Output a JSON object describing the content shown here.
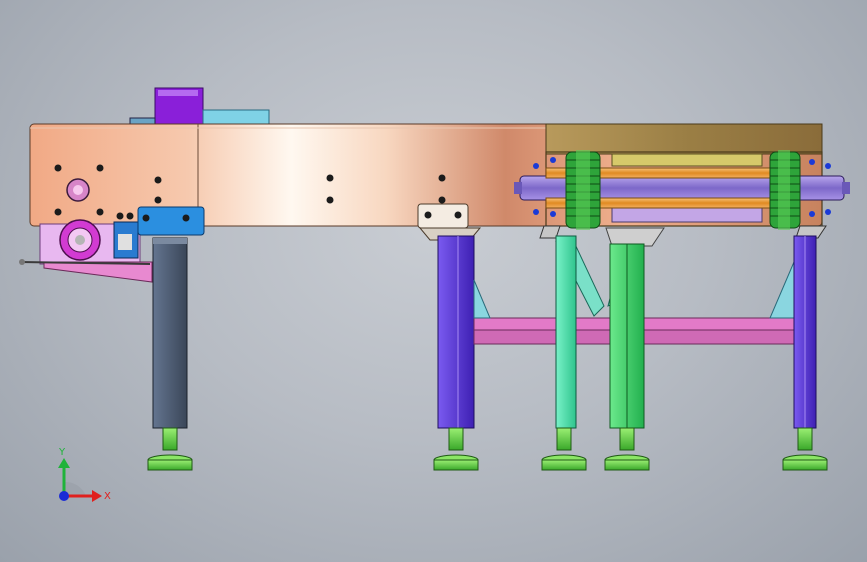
{
  "viewport": {
    "background_colors": [
      "#c9cdd3",
      "#b7bcc4",
      "#9aa1ab"
    ]
  },
  "triad": {
    "x_label": "X",
    "y_label": "Y",
    "x_color": "#e0201e",
    "y_color": "#1fb33a",
    "origin_color": "#1a2bd6"
  },
  "colors": {
    "frame_peach": "#f2b08e",
    "frame_light": "#fbf0e6",
    "frame_dark": "#c8825e",
    "gearbox_purple": "#8a1fd9",
    "motor_pink": "#f0a6e6",
    "leg_slate": "#4b5a6e",
    "leg_violet": "#5d38d8",
    "leg_teal": "#55e3b4",
    "leg_green": "#39d26a",
    "crossbar_pink": "#e27ac8",
    "shaft_orange": "#f3a13b",
    "shaft_lilac": "#a58ce0",
    "sprocket_green": "#2ea43a",
    "foot_green": "#63d24a",
    "bracket_blue": "#2b8fe0",
    "guard_olive": "#b79b5a"
  }
}
